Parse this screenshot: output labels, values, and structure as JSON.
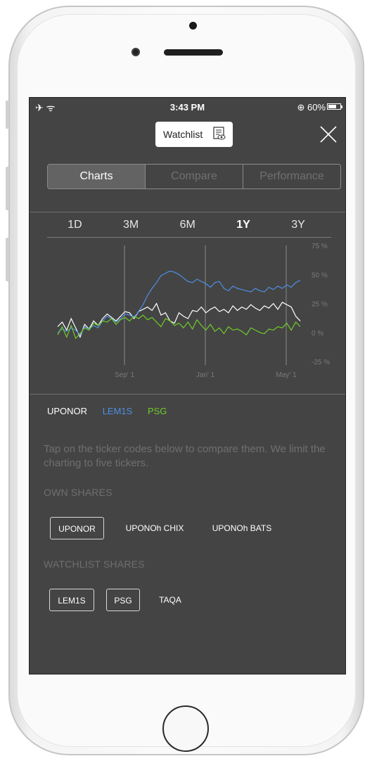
{
  "status_bar": {
    "time": "3:43 PM",
    "battery": "60%",
    "left_icons": "✈ ᯤ"
  },
  "header": {
    "watchlist_label": "Watchlist"
  },
  "segments": [
    {
      "label": "Charts"
    },
    {
      "label": "Compare"
    },
    {
      "label": "Performance"
    }
  ],
  "ranges": [
    "1D",
    "3M",
    "6M",
    "1Y",
    "3Y"
  ],
  "active_range": "1Y",
  "chart_data": {
    "type": "line",
    "x_ticks": [
      "Sep' 1",
      "Jan' 1",
      "May' 1"
    ],
    "y_ticks": [
      "75 %",
      "50 %",
      "25 %",
      "0 %",
      "-25 %"
    ],
    "ylim": [
      -25,
      75
    ],
    "series": [
      {
        "name": "UPONOR",
        "color": "#ffffff",
        "values": [
          5,
          9,
          2,
          12,
          4,
          -4,
          7,
          3,
          10,
          6,
          12,
          16,
          13,
          10,
          14,
          18,
          17,
          12,
          18,
          20,
          22,
          19,
          25,
          15,
          17,
          10,
          8,
          17,
          14,
          12,
          19,
          18,
          22,
          17,
          20,
          22,
          18,
          20,
          17,
          23,
          19,
          22,
          20,
          24,
          21,
          19,
          23,
          21,
          25,
          20,
          26,
          24,
          22,
          14,
          10
        ]
      },
      {
        "name": "LEM1S",
        "color": "#4e8fe3",
        "values": [
          0,
          3,
          1,
          4,
          2,
          -2,
          5,
          3,
          6,
          4,
          10,
          14,
          12,
          9,
          12,
          16,
          15,
          13,
          18,
          24,
          32,
          38,
          43,
          49,
          51,
          53,
          52,
          50,
          47,
          44,
          43,
          46,
          44,
          42,
          39,
          43,
          44,
          38,
          36,
          40,
          38,
          37,
          36,
          35,
          38,
          36,
          35,
          39,
          37,
          40,
          38,
          41,
          39,
          43,
          45
        ]
      },
      {
        "name": "PSG",
        "color": "#6ecc2a",
        "values": [
          -2,
          5,
          -4,
          6,
          -5,
          -1,
          4,
          2,
          8,
          6,
          10,
          9,
          12,
          7,
          11,
          13,
          10,
          14,
          12,
          15,
          11,
          13,
          9,
          5,
          12,
          10,
          6,
          8,
          4,
          9,
          3,
          11,
          6,
          2,
          7,
          1,
          4,
          -1,
          5,
          2,
          3,
          1,
          -2,
          4,
          2,
          0,
          -1,
          3,
          2,
          5,
          4,
          8,
          2,
          9,
          5
        ]
      }
    ]
  },
  "legend": [
    "UPONOR",
    "LEM1S",
    "PSG"
  ],
  "legend_colors": [
    "#ffffff",
    "#4e8fe3",
    "#6ecc2a"
  ],
  "info_text": "Tap on the ticker codes below to compare them. We limit the charting to five tickers.",
  "own_shares": {
    "title": "OWN SHARES",
    "items": [
      {
        "label": "UPONOR",
        "selected": true
      },
      {
        "label": "UPONOh CHIX",
        "selected": false
      },
      {
        "label": "UPONOh BATS",
        "selected": false
      }
    ]
  },
  "watchlist_shares": {
    "title": "WATCHLIST SHARES",
    "items": [
      {
        "label": "LEM1S",
        "selected": true
      },
      {
        "label": "PSG",
        "selected": true
      },
      {
        "label": "TAQA",
        "selected": false
      }
    ]
  },
  "icons": {
    "airplane": "airplane-icon",
    "wifi": "wifi-icon",
    "close": "close-icon",
    "watchlist": "watchlist-eye-icon",
    "lock": "orientation-lock-icon"
  }
}
